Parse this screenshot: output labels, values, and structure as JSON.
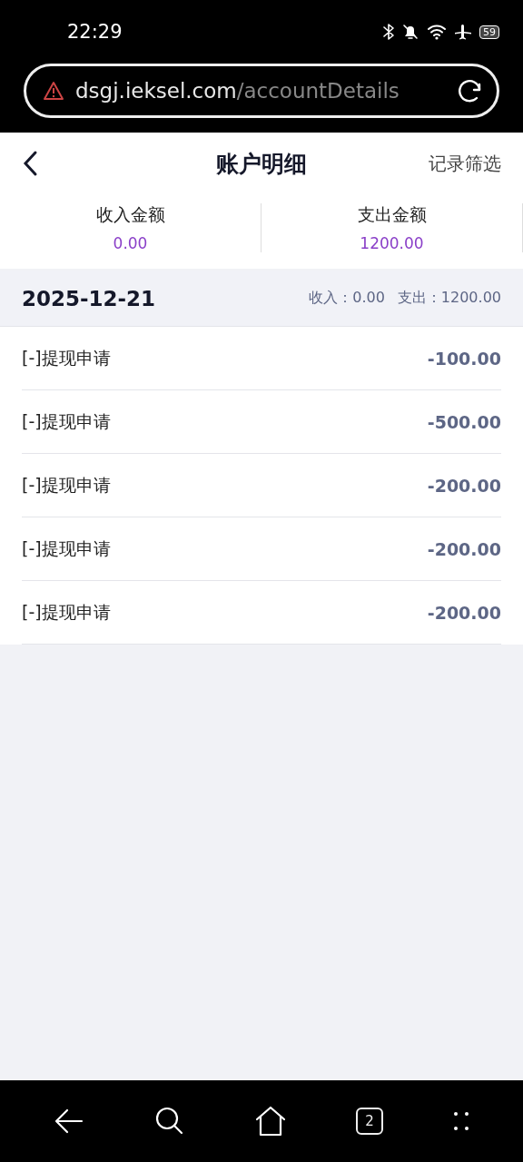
{
  "status_bar": {
    "time": "22:29",
    "battery": "59"
  },
  "address_bar": {
    "domain": "dsgj.ieksel.com",
    "path": "/accountDetails"
  },
  "header": {
    "title": "账户明细",
    "action": "记录筛选"
  },
  "summary": [
    {
      "label": "收入金额",
      "amount": "0.00"
    },
    {
      "label": "支出金额",
      "amount": "1200.00"
    }
  ],
  "groups": [
    {
      "date": "2025-12-21",
      "income": "收入：0.00",
      "expense": "支出：1200.00",
      "records": [
        {
          "title": "[-]提现申请",
          "amount": "-100.00"
        },
        {
          "title": "[-]提现申请",
          "amount": "-500.00"
        },
        {
          "title": "[-]提现申请",
          "amount": "-200.00"
        },
        {
          "title": "[-]提现申请",
          "amount": "-200.00"
        },
        {
          "title": "[-]提现申请",
          "amount": "-200.00"
        }
      ]
    }
  ],
  "nav_bar": {
    "tab_count": "2"
  }
}
